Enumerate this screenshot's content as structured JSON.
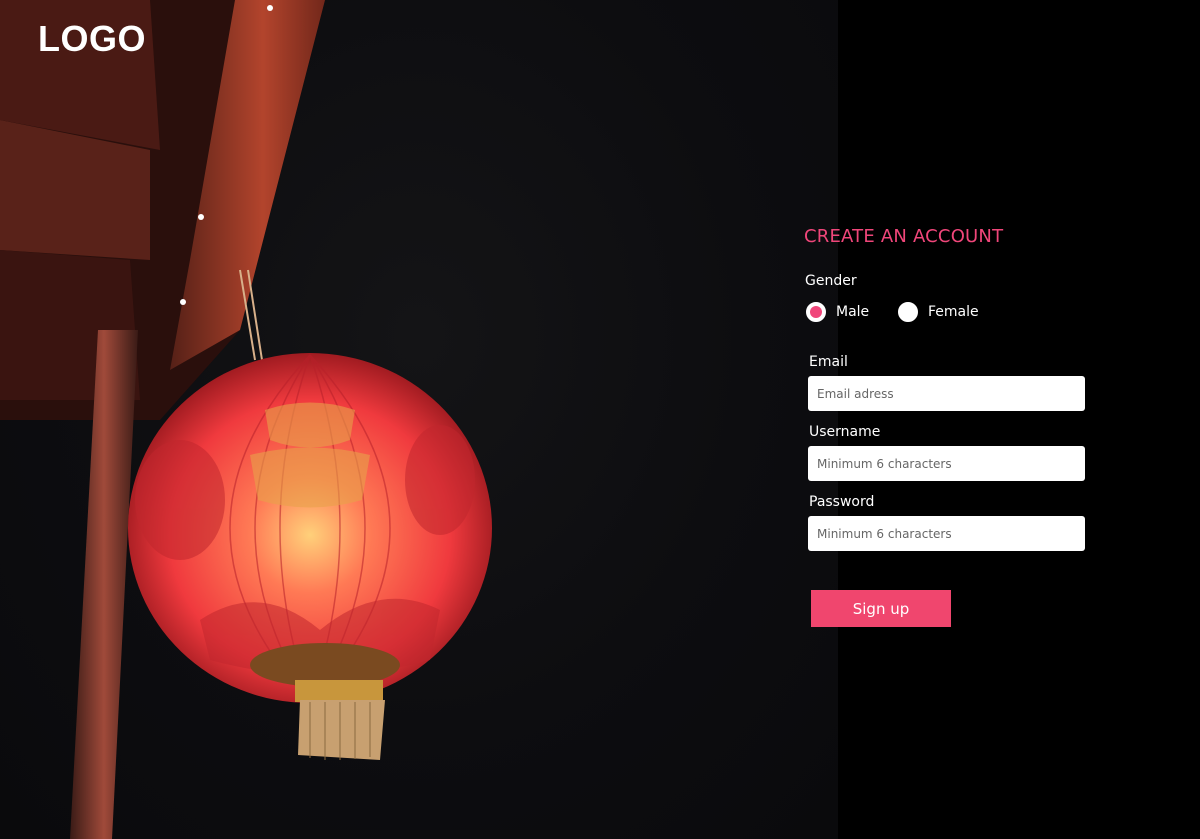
{
  "brand": {
    "logo_text": "LOGO"
  },
  "hero": {
    "image": "red-lantern-photo",
    "accent": "#f0467a"
  },
  "form": {
    "title": "CREATE AN ACCOUNT",
    "gender": {
      "label": "Gender",
      "options": [
        {
          "label": "Male",
          "selected": true
        },
        {
          "label": "Female",
          "selected": false
        }
      ]
    },
    "email": {
      "label": "Email",
      "placeholder": "Email adress",
      "value": ""
    },
    "username": {
      "label": "Username",
      "placeholder": "Minimum 6 characters",
      "value": ""
    },
    "password": {
      "label": "Password",
      "placeholder": "Minimum 6 characters",
      "value": ""
    },
    "submit_label": "Sign up"
  },
  "colors": {
    "accent": "#f0467a",
    "button": "#f0466e",
    "background": "#000000"
  }
}
